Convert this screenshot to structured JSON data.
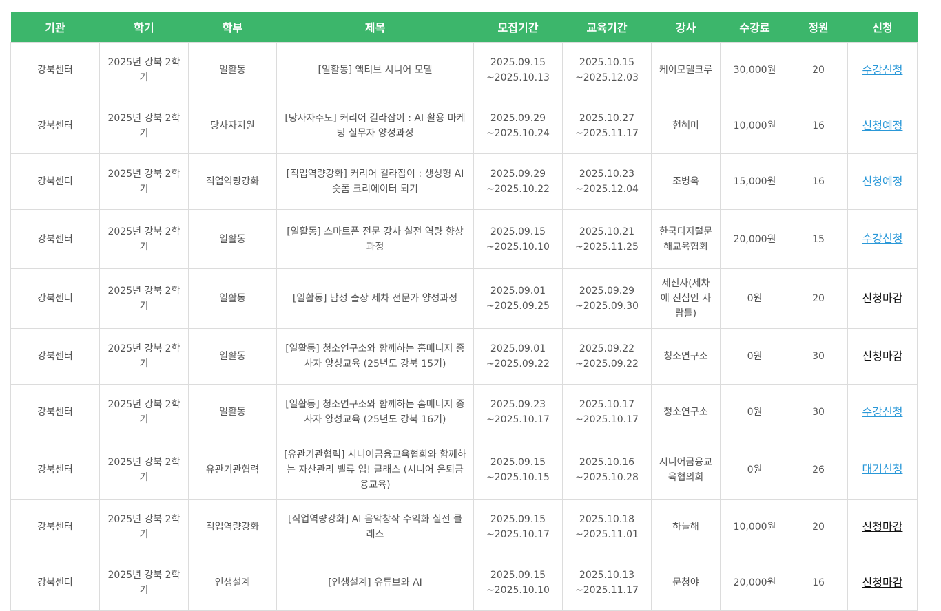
{
  "headers": [
    "기관",
    "학기",
    "학부",
    "제목",
    "모집기간",
    "교육기간",
    "강사",
    "수강료",
    "정원",
    "신청"
  ],
  "rows": [
    {
      "org": "강북센터",
      "term": "2025년 강북 2학기",
      "dept": "일활동",
      "title": "[일활동] 액티브 시니어 모델",
      "recruit_start": "2025.09.15",
      "recruit_end": "~2025.10.13",
      "edu_start": "2025.10.15",
      "edu_end": "~2025.12.03",
      "instructor": "케이모델크루",
      "fee": "30,000원",
      "capacity": "20",
      "status": "수강신청",
      "status_type": "open"
    },
    {
      "org": "강북센터",
      "term": "2025년 강북 2학기",
      "dept": "당사자지원",
      "title": "[당사자주도] 커리어 길라잡이 : AI 활용 마케팅 실무자 양성과정",
      "recruit_start": "2025.09.29",
      "recruit_end": "~2025.10.24",
      "edu_start": "2025.10.27",
      "edu_end": "~2025.11.17",
      "instructor": "현혜미",
      "fee": "10,000원",
      "capacity": "16",
      "status": "신청예정",
      "status_type": "open"
    },
    {
      "org": "강북센터",
      "term": "2025년 강북 2학기",
      "dept": "직업역량강화",
      "title": "[직업역량강화] 커리어 길라잡이 : 생성형 AI 숏폼 크리에이터 되기",
      "recruit_start": "2025.09.29",
      "recruit_end": "~2025.10.22",
      "edu_start": "2025.10.23",
      "edu_end": "~2025.12.04",
      "instructor": "조병옥",
      "fee": "15,000원",
      "capacity": "16",
      "status": "신청예정",
      "status_type": "open"
    },
    {
      "org": "강북센터",
      "term": "2025년 강북 2학기",
      "dept": "일활동",
      "title": "[일활동] 스마트폰 전문 강사 실전 역량 향상 과정",
      "recruit_start": "2025.09.15",
      "recruit_end": "~2025.10.10",
      "edu_start": "2025.10.21",
      "edu_end": "~2025.11.25",
      "instructor": "한국디지털문해교육협회",
      "fee": "20,000원",
      "capacity": "15",
      "status": "수강신청",
      "status_type": "open"
    },
    {
      "org": "강북센터",
      "term": "2025년 강북 2학기",
      "dept": "일활동",
      "title": "[일활동] 남성 출장 세차 전문가 양성과정",
      "recruit_start": "2025.09.01",
      "recruit_end": "~2025.09.25",
      "edu_start": "2025.09.29",
      "edu_end": "~2025.09.30",
      "instructor": "세진사(세차에 진심인 사람들)",
      "fee": "0원",
      "capacity": "20",
      "status": "신청마감",
      "status_type": "closed"
    },
    {
      "org": "강북센터",
      "term": "2025년 강북 2학기",
      "dept": "일활동",
      "title": "[일활동] 청소연구소와 함께하는 홈매니저 종사자 양성교육 (25년도 강북 15기)",
      "recruit_start": "2025.09.01",
      "recruit_end": "~2025.09.22",
      "edu_start": "2025.09.22",
      "edu_end": "~2025.09.22",
      "instructor": "청소연구소",
      "fee": "0원",
      "capacity": "30",
      "status": "신청마감",
      "status_type": "closed"
    },
    {
      "org": "강북센터",
      "term": "2025년 강북 2학기",
      "dept": "일활동",
      "title": "[일활동] 청소연구소와 함께하는 홈매니저 종사자 양성교육 (25년도 강북 16기)",
      "recruit_start": "2025.09.23",
      "recruit_end": "~2025.10.17",
      "edu_start": "2025.10.17",
      "edu_end": "~2025.10.17",
      "instructor": "청소연구소",
      "fee": "0원",
      "capacity": "30",
      "status": "수강신청",
      "status_type": "open"
    },
    {
      "org": "강북센터",
      "term": "2025년 강북 2학기",
      "dept": "유관기관협력",
      "title": "[유관기관협력] 시니어금융교육협회와 함께하는 자산관리 밸류 업! 클래스 (시니어 은퇴금융교육)",
      "recruit_start": "2025.09.15",
      "recruit_end": "~2025.10.15",
      "edu_start": "2025.10.16",
      "edu_end": "~2025.10.28",
      "instructor": "시니어금융교육협의회",
      "fee": "0원",
      "capacity": "26",
      "status": "대기신청",
      "status_type": "open"
    },
    {
      "org": "강북센터",
      "term": "2025년 강북 2학기",
      "dept": "직업역량강화",
      "title": "[직업역량강화] AI 음악창작 수익화 실전 클래스",
      "recruit_start": "2025.09.15",
      "recruit_end": "~2025.10.17",
      "edu_start": "2025.10.18",
      "edu_end": "~2025.11.01",
      "instructor": "하늘해",
      "fee": "10,000원",
      "capacity": "20",
      "status": "신청마감",
      "status_type": "closed"
    },
    {
      "org": "강북센터",
      "term": "2025년 강북 2학기",
      "dept": "인생설계",
      "title": "[인생설계] 유튜브와 AI",
      "recruit_start": "2025.09.15",
      "recruit_end": "~2025.10.10",
      "edu_start": "2025.10.13",
      "edu_end": "~2025.11.17",
      "instructor": "문청야",
      "fee": "20,000원",
      "capacity": "16",
      "status": "신청마감",
      "status_type": "closed"
    }
  ],
  "colors": {
    "header_bg": "#3cb66b",
    "open_link": "#2a98d8",
    "closed_link": "#111111",
    "border": "#dcdcdc"
  }
}
